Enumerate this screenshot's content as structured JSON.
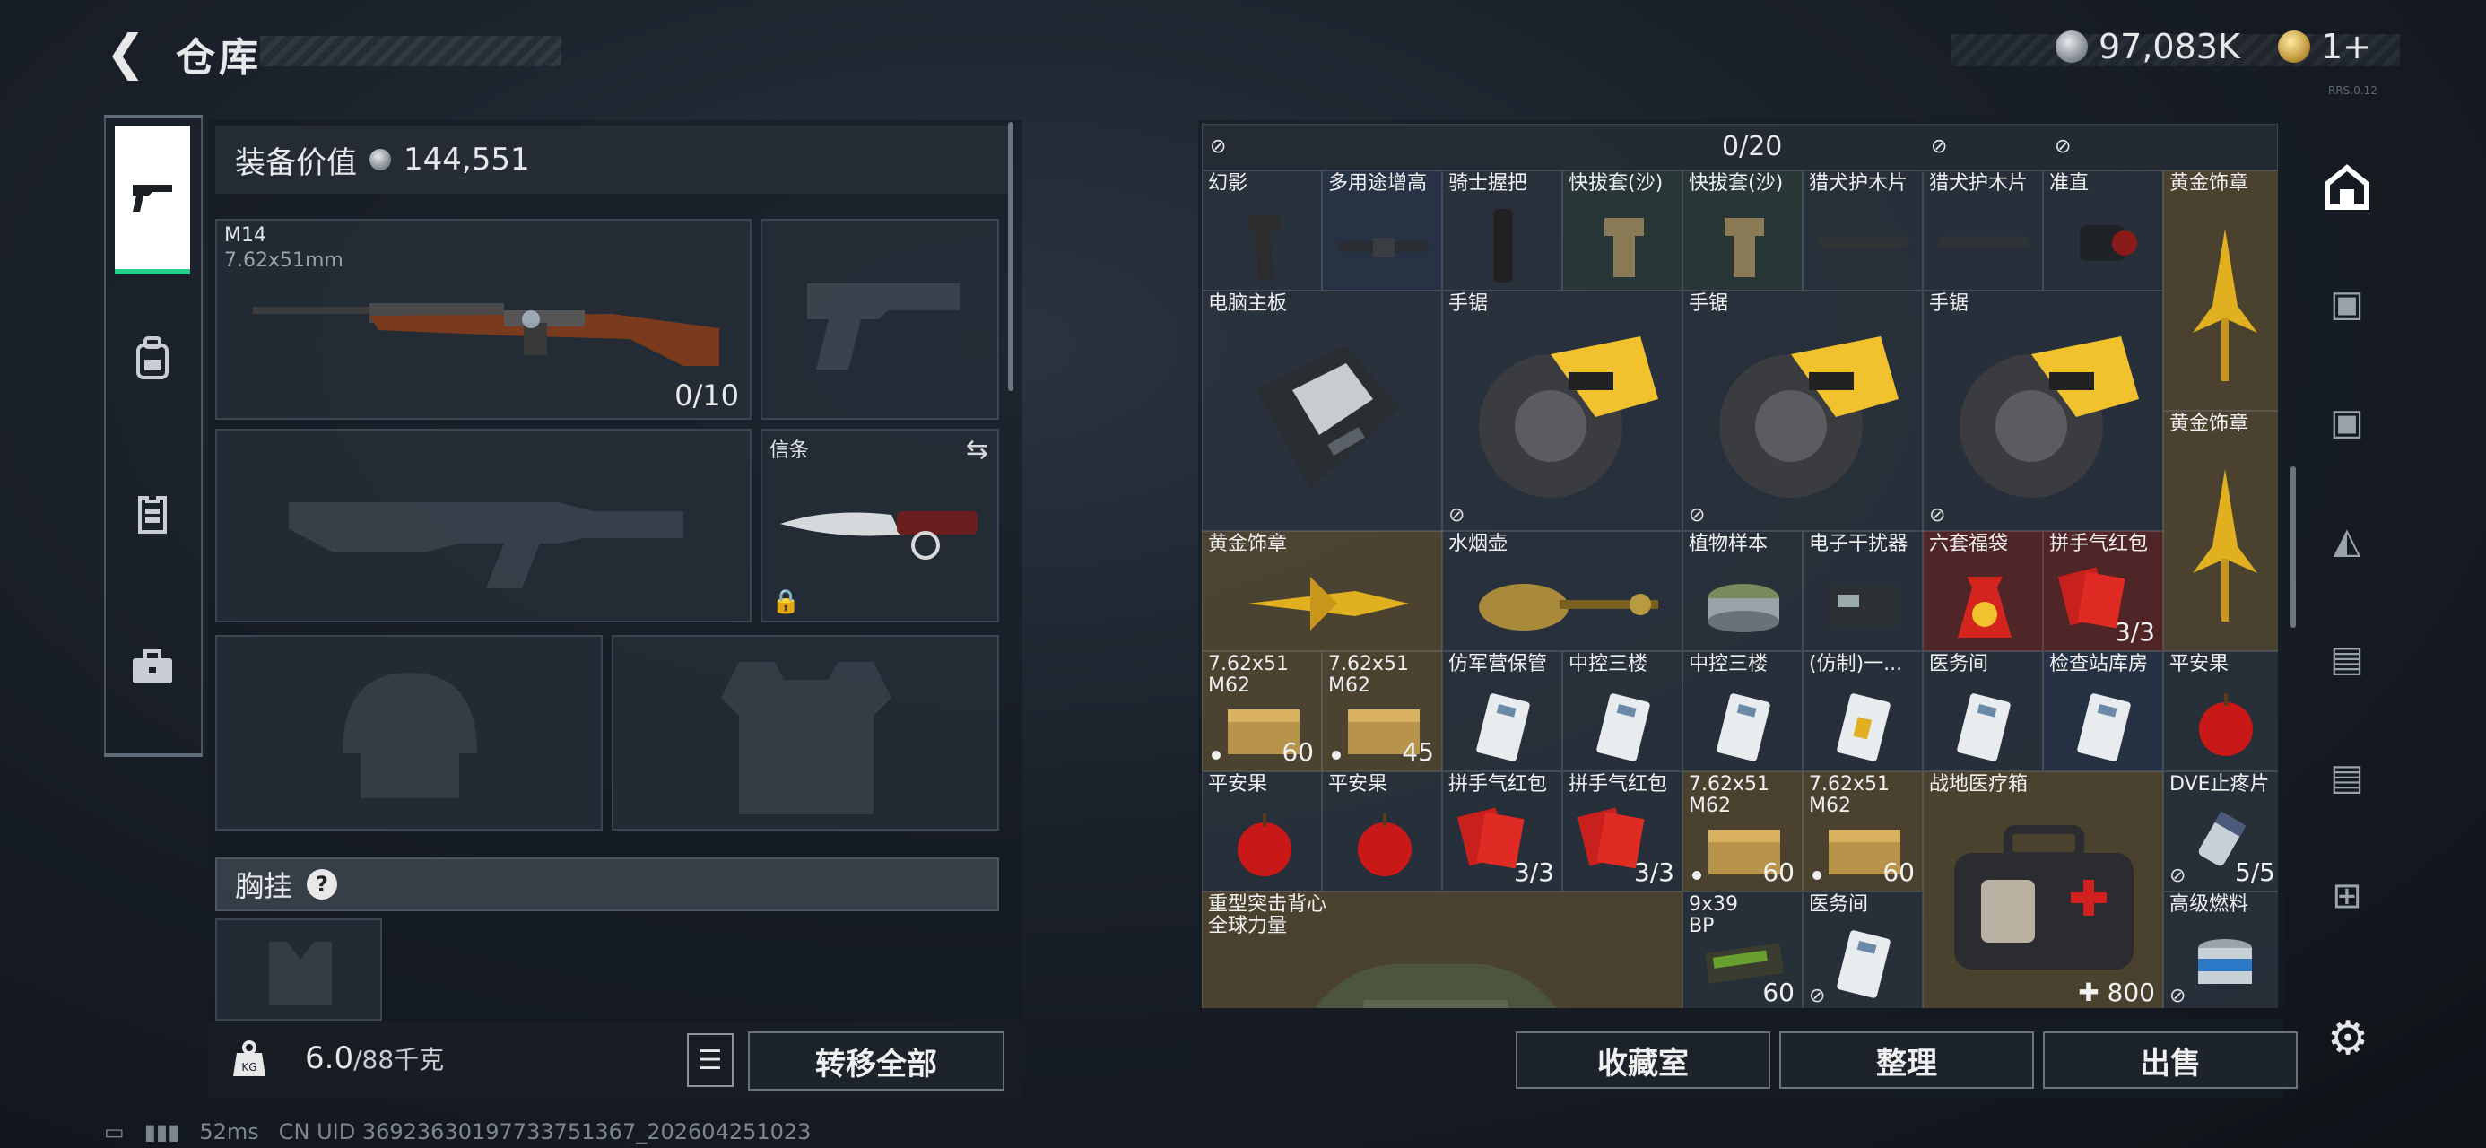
{
  "header": {
    "title": "仓库",
    "money": "97,083K",
    "tickets": "1+",
    "tiny_text": "RRS.0.12"
  },
  "left_nav": [
    {
      "name": "weapons",
      "icon": "pistol-icon"
    },
    {
      "name": "backpack",
      "icon": "backpack-icon"
    },
    {
      "name": "vest",
      "icon": "vest-icon"
    },
    {
      "name": "briefcase",
      "icon": "briefcase-icon"
    }
  ],
  "gear": {
    "value_label": "装备价值",
    "value": "144,551",
    "primary": {
      "name": "M14",
      "caliber": "7.62x51mm",
      "ammo": "0/10"
    },
    "melee_label": "信条",
    "chest_label": "胸挂"
  },
  "bottom": {
    "weight": "6.0",
    "weight_max": "/88千克",
    "transfer_all": "转移全部"
  },
  "stash": {
    "capacity": "0/20",
    "buttons": {
      "collection": "收藏室",
      "sort": "整理",
      "sell": "出售"
    }
  },
  "status": {
    "ping": "52ms",
    "uid": "CN UID 36923630197733751367_202604251023"
  },
  "cells": [
    {
      "id": "c1",
      "name": "幻影"
    },
    {
      "id": "c2",
      "name": "多用途增高"
    },
    {
      "id": "c3",
      "name": "骑士握把"
    },
    {
      "id": "c4",
      "name": "快拔套(沙)"
    },
    {
      "id": "c5",
      "name": "快拔套(沙)"
    },
    {
      "id": "c6",
      "name": "猎犬护木片"
    },
    {
      "id": "c7",
      "name": "猎犬护木片"
    },
    {
      "id": "c8",
      "name": "准直"
    },
    {
      "id": "c9",
      "name": "黄金饰章"
    },
    {
      "id": "c10",
      "name": "电脑主板"
    },
    {
      "id": "c11",
      "name": "手锯"
    },
    {
      "id": "c12",
      "name": "手锯"
    },
    {
      "id": "c13",
      "name": "手锯"
    },
    {
      "id": "c14",
      "name": "黄金饰章"
    },
    {
      "id": "c15",
      "name": "黄金饰章"
    },
    {
      "id": "c16",
      "name": "水烟壶"
    },
    {
      "id": "c17",
      "name": "植物样本"
    },
    {
      "id": "c18",
      "name": "电子干扰器"
    },
    {
      "id": "c19",
      "name": "六套福袋"
    },
    {
      "id": "c20",
      "name": "拼手气红包",
      "count": "3/3"
    },
    {
      "id": "c21",
      "name": "7.62x51\nM62",
      "count": "60"
    },
    {
      "id": "c22",
      "name": "7.62x51\nM62",
      "count": "45"
    },
    {
      "id": "c23",
      "name": "仿军营保管"
    },
    {
      "id": "c24",
      "name": "中控三楼"
    },
    {
      "id": "c25",
      "name": "中控三楼"
    },
    {
      "id": "c26",
      "name": "(仿制)一..."
    },
    {
      "id": "c27",
      "name": "医务间"
    },
    {
      "id": "c28",
      "name": "检查站库房"
    },
    {
      "id": "c29",
      "name": "平安果"
    },
    {
      "id": "c30",
      "name": "平安果"
    },
    {
      "id": "c31",
      "name": "平安果"
    },
    {
      "id": "c32",
      "name": "拼手气红包",
      "count": "3/3"
    },
    {
      "id": "c33",
      "name": "拼手气红包",
      "count": "3/3"
    },
    {
      "id": "c34",
      "name": "7.62x51\nM62",
      "count": "60"
    },
    {
      "id": "c35",
      "name": "7.62x51\nM62",
      "count": "60"
    },
    {
      "id": "c36",
      "name": "战地医疗箱",
      "count": "✚ 800"
    },
    {
      "id": "c37",
      "name": "DVE止疼片",
      "count": "5/5"
    },
    {
      "id": "c38",
      "name": "重型突击背心\n全球力量"
    },
    {
      "id": "c39",
      "name": "9x39\nBP",
      "count": "60"
    },
    {
      "id": "c40",
      "name": "医务间"
    },
    {
      "id": "c41",
      "name": "高级燃料"
    }
  ]
}
